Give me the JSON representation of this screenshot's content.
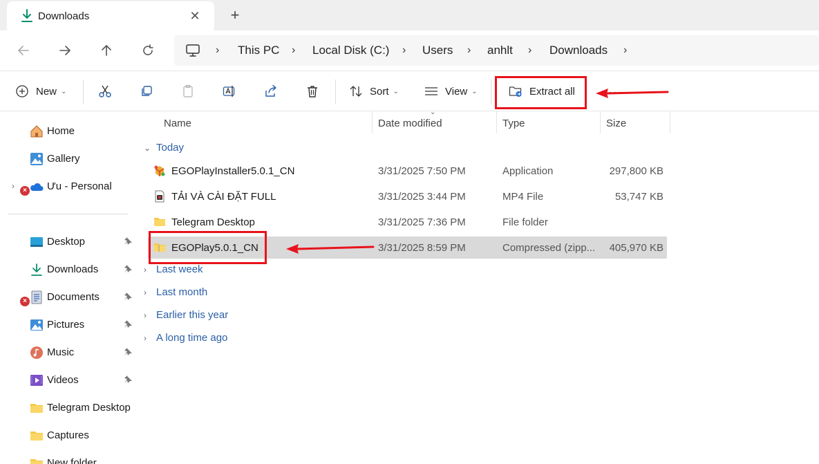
{
  "tab": {
    "title": "Downloads",
    "close_glyph": "✕",
    "new_tab_glyph": "+"
  },
  "nav": {
    "back_icon": "arrow-left-icon",
    "forward_icon": "arrow-right-icon",
    "up_icon": "arrow-up-icon",
    "refresh_icon": "refresh-icon",
    "breadcrumbs": [
      "This PC",
      "Local Disk (C:)",
      "Users",
      "anhlt",
      "Downloads"
    ],
    "chevron": "›"
  },
  "toolbar": {
    "new_label": "New",
    "sort_label": "Sort",
    "view_label": "View",
    "extract_label": "Extract all",
    "more_glyph": "···",
    "caret": "⌄"
  },
  "sidebar": {
    "items": [
      {
        "label": "Home",
        "icon": "home-icon"
      },
      {
        "label": "Gallery",
        "icon": "gallery-icon"
      },
      {
        "label": "Ưu - Personal",
        "icon": "onedrive-cloud-icon"
      },
      {
        "label": "Desktop",
        "icon": "desktop-icon"
      },
      {
        "label": "Downloads",
        "icon": "download-icon"
      },
      {
        "label": "Documents",
        "icon": "documents-icon"
      },
      {
        "label": "Pictures",
        "icon": "pictures-icon"
      },
      {
        "label": "Music",
        "icon": "music-icon"
      },
      {
        "label": "Videos",
        "icon": "videos-icon"
      },
      {
        "label": "Telegram Desktop",
        "icon": "folder-icon"
      },
      {
        "label": "Captures",
        "icon": "folder-icon"
      },
      {
        "label": "New folder",
        "icon": "folder-icon"
      }
    ],
    "expander_glyph": "›",
    "error_glyph": "×"
  },
  "columns": {
    "name": "Name",
    "date": "Date modified",
    "type": "Type",
    "size": "Size",
    "sort_caret": "⌄"
  },
  "groups": {
    "today": "Today",
    "last_week": "Last week",
    "last_month": "Last month",
    "earlier_this_year": "Earlier this year",
    "long_time_ago": "A long time ago",
    "expanded_glyph": "⌄",
    "collapsed_glyph": "›"
  },
  "files": [
    {
      "name": "EGOPlayInstaller5.0.1_CN",
      "date": "3/31/2025 7:50 PM",
      "type": "Application",
      "size": "297,800 KB",
      "icon": "installer-icon"
    },
    {
      "name": "TẢI VÀ CÀI ĐẶT FULL",
      "date": "3/31/2025 3:44 PM",
      "type": "MP4 File",
      "size": "53,747 KB",
      "icon": "video-file-icon"
    },
    {
      "name": "Telegram Desktop",
      "date": "3/31/2025 7:36 PM",
      "type": "File folder",
      "size": "",
      "icon": "folder-icon"
    },
    {
      "name": "EGOPlay5.0.1_CN",
      "date": "3/31/2025 8:59 PM",
      "type": "Compressed (zipp...",
      "size": "405,970 KB",
      "icon": "zip-folder-icon",
      "selected": true
    }
  ],
  "colors": {
    "accent": "#0a7c5c",
    "link": "#2a5fa8",
    "annotation": "#e8131b",
    "selection": "#d9d9d9"
  }
}
